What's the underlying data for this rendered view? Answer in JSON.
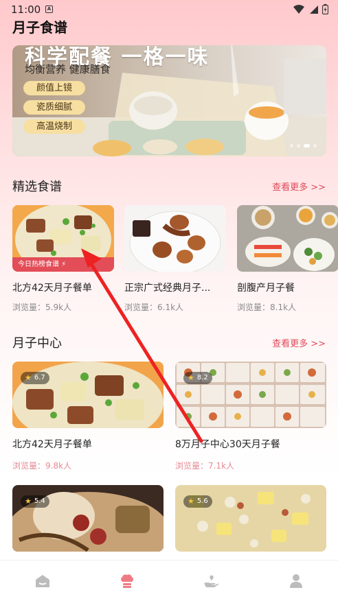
{
  "status_bar": {
    "time": "11:00",
    "notification_icon": "A"
  },
  "app": {
    "title": "月子食谱"
  },
  "banner": {
    "title": "科学配餐 一格一味",
    "subtitle": "均衡营养 健康膳食",
    "tags": [
      "颜值上镜",
      "瓷质细腻",
      "高温烧制"
    ]
  },
  "featured": {
    "section_title": "精选食谱",
    "more_label": "查看更多 >>",
    "hot_label": "今日热榜食谱 ⚡",
    "items": [
      {
        "name": "北方42天月子餐单",
        "views": "浏览量：5.9k人"
      },
      {
        "name": "正宗广式经典月子...",
        "views": "浏览量：6.1k人"
      },
      {
        "name": "剖腹产月子餐",
        "views": "浏览量：8.1k人"
      }
    ]
  },
  "center": {
    "section_title": "月子中心",
    "more_label": "查看更多 >>",
    "items": [
      {
        "rating": "6.7",
        "name": "北方42天月子餐单",
        "views": "浏览量：9.8k人"
      },
      {
        "rating": "8.2",
        "name": "8万月子中心30天月子餐",
        "views": "浏览量：7.1k人"
      },
      {
        "rating": "5.4"
      },
      {
        "rating": "5.6"
      }
    ]
  },
  "bottom_nav": [
    {
      "icon": "home-icon",
      "active": false
    },
    {
      "icon": "chef-hat-icon",
      "active": true
    },
    {
      "icon": "care-hand-icon",
      "active": false
    },
    {
      "icon": "profile-icon",
      "active": false
    }
  ],
  "colors": {
    "accent": "#e24d58",
    "active_nav": "#f07a84",
    "inactive_nav": "#bcbcbc"
  }
}
